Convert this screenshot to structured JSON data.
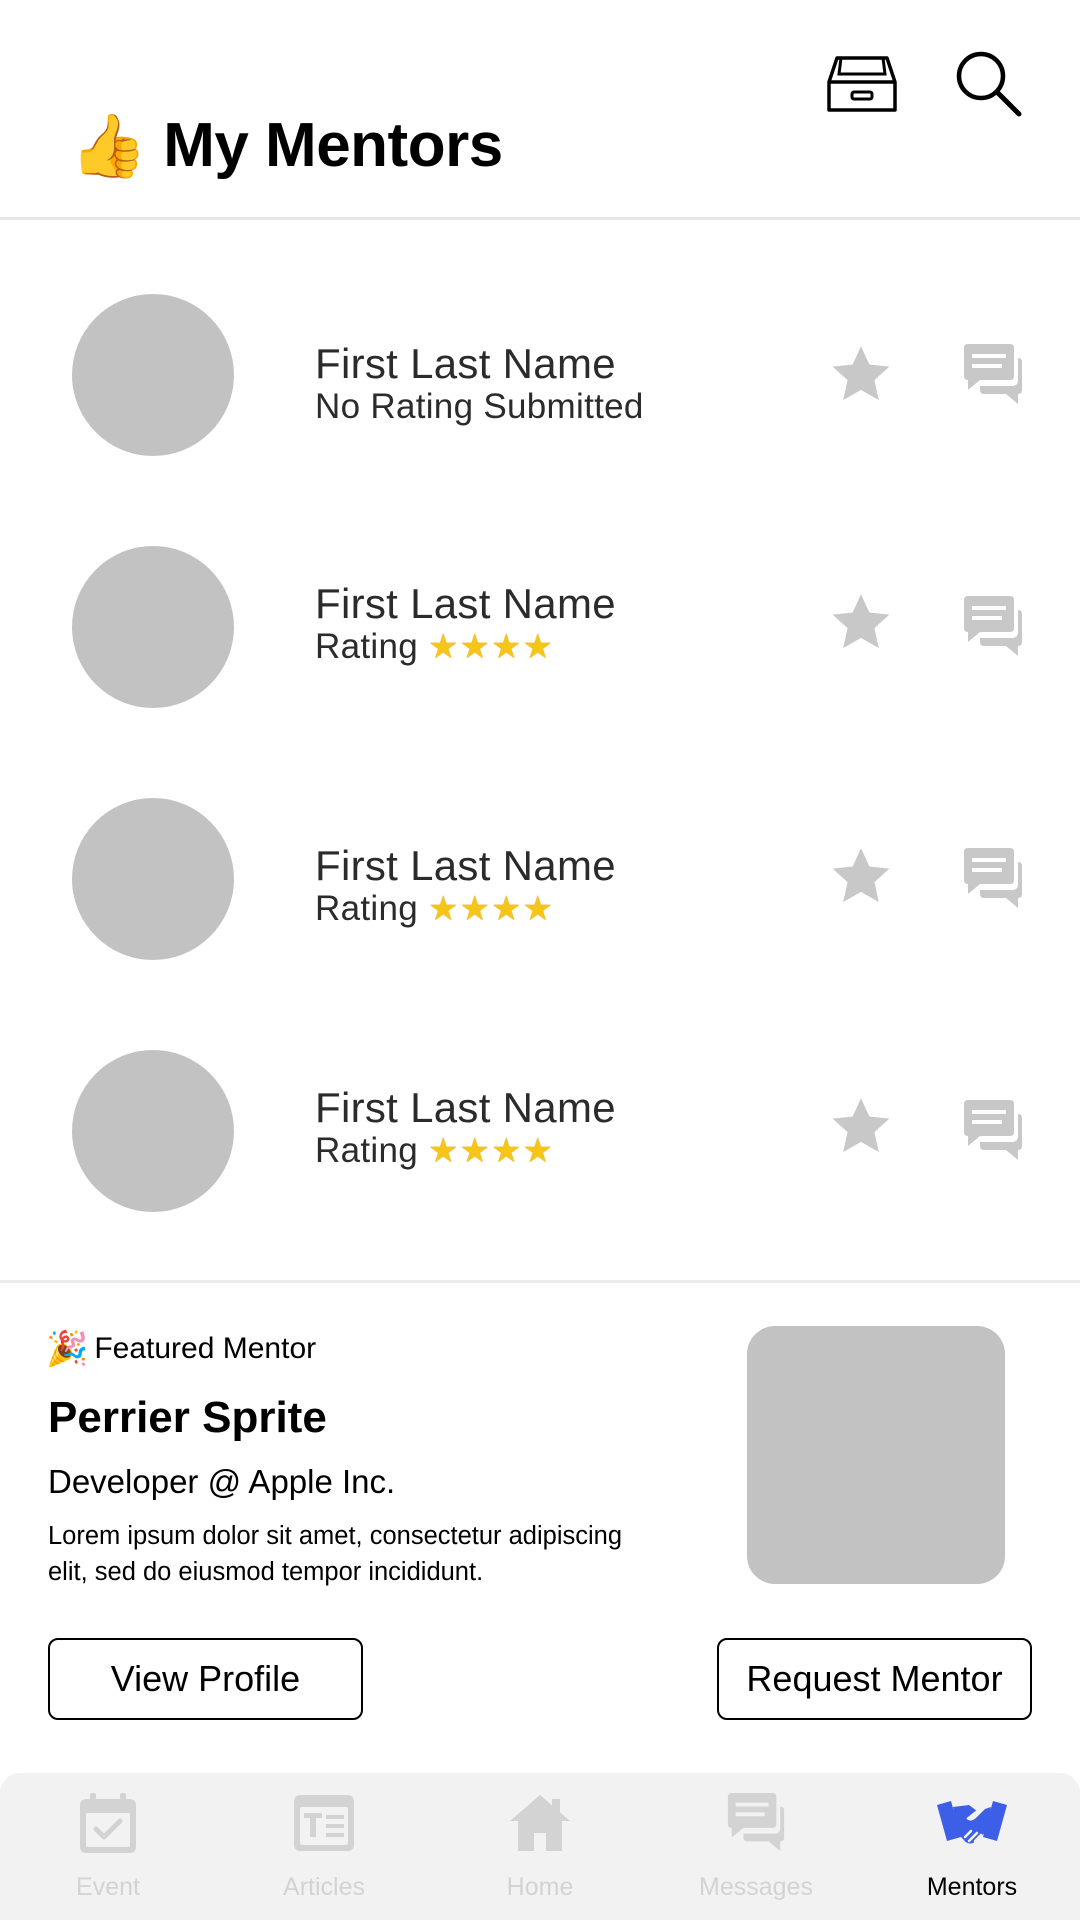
{
  "header": {
    "title_emoji": "👍",
    "title": "My Mentors",
    "inbox_icon": "inbox-icon",
    "search_icon": "search-icon"
  },
  "mentors": [
    {
      "name": "First Last Name",
      "rating_text": "No Rating Submitted",
      "stars": "",
      "rating_value": null
    },
    {
      "name": "First Last Name",
      "rating_text": "Rating",
      "stars": "★★★★",
      "rating_value": 4
    },
    {
      "name": "First Last Name",
      "rating_text": "Rating",
      "stars": "★★★★",
      "rating_value": 4
    },
    {
      "name": "First Last Name",
      "rating_text": "Rating",
      "stars": "★★★★",
      "rating_value": 4
    }
  ],
  "featured": {
    "tag_emoji": "🎉",
    "tag": "Featured Mentor",
    "name": "Perrier Sprite",
    "role": "Developer @ Apple Inc.",
    "description": "Lorem ipsum dolor sit amet, consectetur adipiscing elit, sed do eiusmod tempor incididunt.",
    "view_profile_label": "View Profile",
    "request_mentor_label": "Request Mentor"
  },
  "nav": {
    "items": [
      {
        "label": "Event",
        "icon": "calendar-check-icon",
        "active": false
      },
      {
        "label": "Articles",
        "icon": "article-icon",
        "active": false
      },
      {
        "label": "Home",
        "icon": "home-icon",
        "active": false
      },
      {
        "label": "Messages",
        "icon": "messages-icon",
        "active": false
      },
      {
        "label": "Mentors",
        "icon": "handshake-icon",
        "active": true
      }
    ]
  },
  "colors": {
    "avatar_placeholder": "#c2c2c2",
    "icon_gray": "#c8c8c8",
    "nav_background": "#f2f2f2",
    "nav_inactive": "#d3d3d3",
    "nav_active_icon": "#3d5fe8",
    "star_gold": "#f5c518"
  }
}
